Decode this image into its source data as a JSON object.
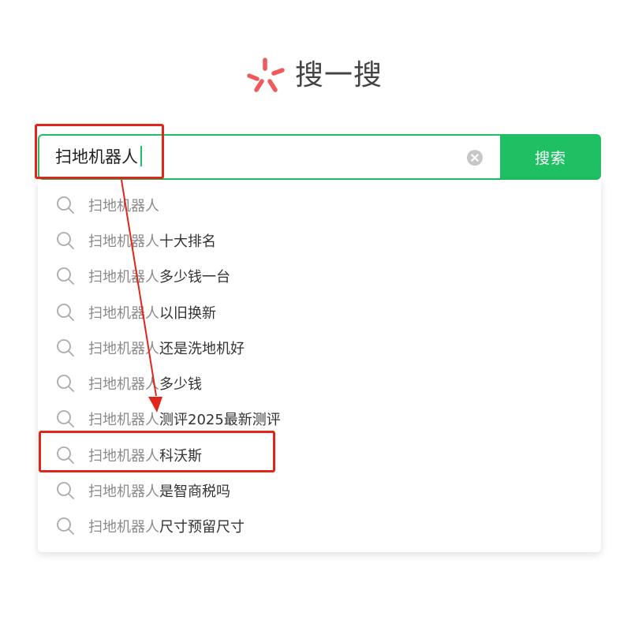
{
  "logo": {
    "text": "搜一搜",
    "mark_color": "#f05a5a"
  },
  "search": {
    "query": "扫地机器人",
    "button_label": "搜索",
    "accent_color": "#1fbf64"
  },
  "suggestions": [
    {
      "prefix": "扫地机器人",
      "suffix": ""
    },
    {
      "prefix": "扫地机器人",
      "suffix": "十大排名"
    },
    {
      "prefix": "扫地机器人",
      "suffix": "多少钱一台"
    },
    {
      "prefix": "扫地机器人",
      "suffix": "以旧换新"
    },
    {
      "prefix": "扫地机器人",
      "suffix": "还是洗地机好"
    },
    {
      "prefix": "扫地机器人",
      "suffix": "多少钱"
    },
    {
      "prefix": "扫地机器人",
      "suffix": "测评2025最新测评"
    },
    {
      "prefix": "扫地机器人",
      "suffix": "科沃斯"
    },
    {
      "prefix": "扫地机器人",
      "suffix": "是智商税吗"
    },
    {
      "prefix": "扫地机器人",
      "suffix": "尺寸预留尺寸"
    }
  ],
  "annotations": {
    "color": "#e0251b",
    "highlighted_suggestion": "扫地机器人科沃斯"
  }
}
